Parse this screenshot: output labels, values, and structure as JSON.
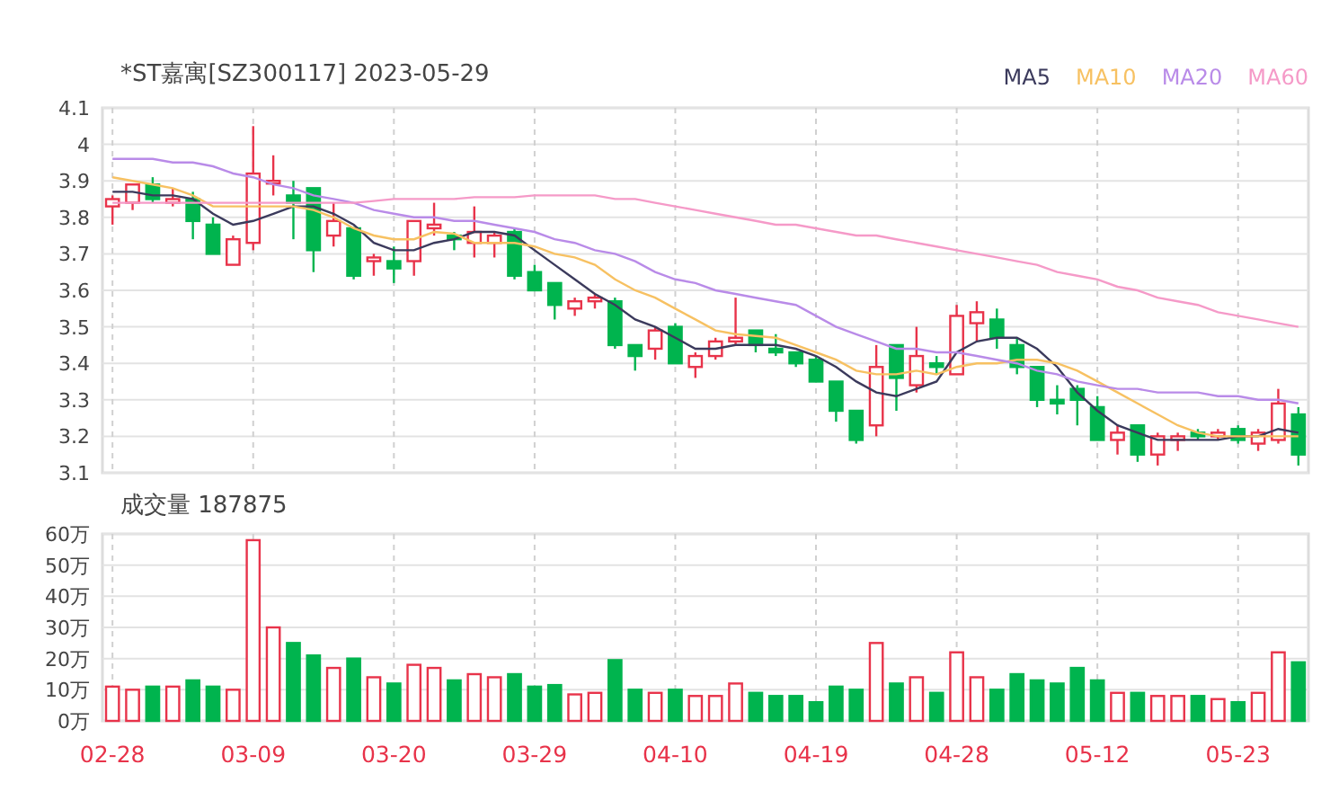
{
  "header": {
    "title": "*ST嘉寓[SZ300117] 2023-05-29"
  },
  "price_chart": {
    "chart_data": {
      "type": "candlestick",
      "grid": true,
      "ylim": [
        3.1,
        4.1
      ],
      "yticks": [
        3.1,
        3.2,
        3.3,
        3.4,
        3.5,
        3.6,
        3.7,
        3.8,
        3.9,
        4,
        4.1
      ],
      "categories": [
        null,
        null,
        null,
        null,
        null,
        null,
        null,
        null,
        null,
        null,
        null,
        null,
        null,
        null,
        null,
        null,
        null,
        null,
        null,
        null,
        null,
        null,
        null,
        null,
        null,
        null,
        null,
        null,
        null,
        null,
        null,
        null,
        null,
        null,
        null,
        null,
        null,
        null,
        null,
        null,
        null,
        null,
        null,
        null,
        null,
        null,
        null,
        null,
        null,
        null,
        null,
        null,
        null,
        null,
        null,
        null,
        null,
        null,
        null,
        null
      ],
      "ohlc": [
        [
          3.83,
          3.86,
          3.78,
          3.85
        ],
        [
          3.84,
          3.89,
          3.82,
          3.89
        ],
        [
          3.89,
          3.91,
          3.84,
          3.85
        ],
        [
          3.84,
          3.88,
          3.83,
          3.85
        ],
        [
          3.85,
          3.87,
          3.74,
          3.79
        ],
        [
          3.78,
          3.8,
          3.7,
          3.7
        ],
        [
          3.67,
          3.75,
          3.67,
          3.74
        ],
        [
          3.73,
          4.05,
          3.71,
          3.92
        ],
        [
          3.895,
          3.97,
          3.86,
          3.9
        ],
        [
          3.86,
          3.9,
          3.74,
          3.84
        ],
        [
          3.88,
          3.88,
          3.65,
          3.71
        ],
        [
          3.75,
          3.84,
          3.72,
          3.79
        ],
        [
          3.77,
          3.77,
          3.63,
          3.64
        ],
        [
          3.68,
          3.7,
          3.64,
          3.69
        ],
        [
          3.68,
          3.72,
          3.62,
          3.66
        ],
        [
          3.68,
          3.79,
          3.64,
          3.79
        ],
        [
          3.77,
          3.84,
          3.75,
          3.78
        ],
        [
          3.75,
          3.76,
          3.71,
          3.74
        ],
        [
          3.73,
          3.83,
          3.69,
          3.76
        ],
        [
          3.73,
          3.76,
          3.69,
          3.75
        ],
        [
          3.76,
          3.77,
          3.63,
          3.64
        ],
        [
          3.65,
          3.67,
          3.6,
          3.6
        ],
        [
          3.62,
          3.62,
          3.52,
          3.56
        ],
        [
          3.55,
          3.58,
          3.53,
          3.57
        ],
        [
          3.57,
          3.59,
          3.55,
          3.58
        ],
        [
          3.57,
          3.58,
          3.44,
          3.45
        ],
        [
          3.45,
          3.45,
          3.38,
          3.42
        ],
        [
          3.44,
          3.5,
          3.41,
          3.49
        ],
        [
          3.5,
          3.51,
          3.4,
          3.4
        ],
        [
          3.39,
          3.43,
          3.36,
          3.42
        ],
        [
          3.42,
          3.47,
          3.41,
          3.46
        ],
        [
          3.46,
          3.58,
          3.45,
          3.47
        ],
        [
          3.49,
          3.49,
          3.43,
          3.45
        ],
        [
          3.44,
          3.48,
          3.42,
          3.43
        ],
        [
          3.43,
          3.43,
          3.39,
          3.4
        ],
        [
          3.41,
          3.42,
          3.35,
          3.35
        ],
        [
          3.35,
          3.35,
          3.24,
          3.27
        ],
        [
          3.27,
          3.27,
          3.18,
          3.19
        ],
        [
          3.23,
          3.45,
          3.2,
          3.39
        ],
        [
          3.45,
          3.45,
          3.27,
          3.36
        ],
        [
          3.34,
          3.5,
          3.32,
          3.42
        ],
        [
          3.4,
          3.42,
          3.37,
          3.39
        ],
        [
          3.37,
          3.56,
          3.37,
          3.53
        ],
        [
          3.51,
          3.57,
          3.46,
          3.54
        ],
        [
          3.52,
          3.55,
          3.44,
          3.47
        ],
        [
          3.45,
          3.47,
          3.37,
          3.39
        ],
        [
          3.39,
          3.39,
          3.28,
          3.3
        ],
        [
          3.3,
          3.34,
          3.26,
          3.29
        ],
        [
          3.33,
          3.34,
          3.23,
          3.3
        ],
        [
          3.28,
          3.31,
          3.19,
          3.19
        ],
        [
          3.19,
          3.23,
          3.15,
          3.21
        ],
        [
          3.23,
          3.23,
          3.13,
          3.15
        ],
        [
          3.15,
          3.21,
          3.12,
          3.2
        ],
        [
          3.19,
          3.21,
          3.16,
          3.2
        ],
        [
          3.21,
          3.22,
          3.19,
          3.2
        ],
        [
          3.2,
          3.22,
          3.19,
          3.21
        ],
        [
          3.22,
          3.23,
          3.18,
          3.19
        ],
        [
          3.18,
          3.22,
          3.16,
          3.21
        ],
        [
          3.19,
          3.33,
          3.18,
          3.29
        ],
        [
          3.26,
          3.28,
          3.12,
          3.15
        ]
      ],
      "series": [
        {
          "name": "MA5",
          "type": "line",
          "color": "#3b3a5c",
          "values": [
            3.87,
            3.87,
            3.86,
            3.86,
            3.85,
            3.81,
            3.78,
            3.79,
            3.81,
            3.83,
            3.83,
            3.81,
            3.78,
            3.73,
            3.71,
            3.71,
            3.73,
            3.74,
            3.76,
            3.76,
            3.75,
            3.71,
            3.67,
            3.63,
            3.59,
            3.56,
            3.52,
            3.5,
            3.47,
            3.44,
            3.44,
            3.45,
            3.45,
            3.45,
            3.44,
            3.42,
            3.39,
            3.35,
            3.32,
            3.31,
            3.33,
            3.35,
            3.43,
            3.46,
            3.47,
            3.47,
            3.44,
            3.39,
            3.32,
            3.27,
            3.23,
            3.21,
            3.19,
            3.19,
            3.19,
            3.19,
            3.2,
            3.2,
            3.22,
            3.21
          ]
        },
        {
          "name": "MA10",
          "type": "line",
          "color": "#f7c162",
          "values": [
            3.91,
            3.9,
            3.89,
            3.88,
            3.86,
            3.83,
            3.83,
            3.83,
            3.83,
            3.83,
            3.82,
            3.8,
            3.77,
            3.75,
            3.74,
            3.74,
            3.76,
            3.755,
            3.73,
            3.73,
            3.73,
            3.72,
            3.7,
            3.69,
            3.67,
            3.63,
            3.6,
            3.58,
            3.55,
            3.52,
            3.49,
            3.48,
            3.475,
            3.47,
            3.45,
            3.43,
            3.41,
            3.38,
            3.37,
            3.37,
            3.38,
            3.37,
            3.39,
            3.4,
            3.4,
            3.41,
            3.41,
            3.4,
            3.38,
            3.35,
            3.32,
            3.29,
            3.26,
            3.23,
            3.21,
            3.2,
            3.2,
            3.2,
            3.2,
            3.2
          ]
        },
        {
          "name": "MA20",
          "type": "line",
          "color": "#b98be8",
          "values": [
            3.96,
            3.96,
            3.96,
            3.95,
            3.95,
            3.94,
            3.92,
            3.91,
            3.89,
            3.88,
            3.86,
            3.85,
            3.84,
            3.82,
            3.81,
            3.8,
            3.8,
            3.79,
            3.79,
            3.78,
            3.77,
            3.76,
            3.74,
            3.73,
            3.71,
            3.7,
            3.68,
            3.65,
            3.63,
            3.62,
            3.6,
            3.59,
            3.58,
            3.57,
            3.56,
            3.53,
            3.5,
            3.48,
            3.46,
            3.44,
            3.44,
            3.43,
            3.43,
            3.42,
            3.41,
            3.4,
            3.38,
            3.37,
            3.35,
            3.34,
            3.33,
            3.33,
            3.32,
            3.32,
            3.32,
            3.31,
            3.31,
            3.3,
            3.3,
            3.29
          ]
        },
        {
          "name": "MA60",
          "type": "line",
          "color": "#f59ac8",
          "values": [
            3.84,
            3.84,
            3.84,
            3.84,
            3.84,
            3.84,
            3.84,
            3.84,
            3.84,
            3.84,
            3.84,
            3.84,
            3.84,
            3.845,
            3.85,
            3.85,
            3.85,
            3.85,
            3.855,
            3.855,
            3.855,
            3.86,
            3.86,
            3.86,
            3.86,
            3.85,
            3.85,
            3.84,
            3.83,
            3.82,
            3.81,
            3.8,
            3.79,
            3.78,
            3.78,
            3.77,
            3.76,
            3.75,
            3.75,
            3.74,
            3.73,
            3.72,
            3.71,
            3.7,
            3.69,
            3.68,
            3.67,
            3.65,
            3.64,
            3.63,
            3.61,
            3.6,
            3.58,
            3.57,
            3.56,
            3.54,
            3.53,
            3.52,
            3.51,
            3.5
          ]
        }
      ]
    }
  },
  "volume_chart": {
    "chart_data": {
      "type": "bar",
      "grid": true,
      "title": "成交量 187875",
      "ylim": [
        0,
        60
      ],
      "yticks": [
        {
          "value": 0,
          "label": "0万"
        },
        {
          "value": 10,
          "label": "10万"
        },
        {
          "value": 20,
          "label": "20万"
        },
        {
          "value": 30,
          "label": "30万"
        },
        {
          "value": 40,
          "label": "40万"
        },
        {
          "value": 50,
          "label": "50万"
        },
        {
          "value": 60,
          "label": "60万"
        }
      ],
      "categories": [
        "02-28",
        null,
        null,
        null,
        null,
        null,
        null,
        "03-09",
        null,
        null,
        null,
        null,
        null,
        null,
        "03-20",
        null,
        null,
        null,
        null,
        null,
        null,
        "03-29",
        null,
        null,
        null,
        null,
        null,
        null,
        "04-10",
        null,
        null,
        null,
        null,
        null,
        null,
        "04-19",
        null,
        null,
        null,
        null,
        null,
        null,
        "04-28",
        null,
        null,
        null,
        null,
        null,
        null,
        "05-12",
        null,
        null,
        null,
        null,
        null,
        null,
        "05-23",
        null,
        null,
        null
      ],
      "values": [
        11,
        10,
        11,
        11,
        13,
        11,
        10,
        58,
        30,
        25,
        21,
        17,
        20,
        14,
        12,
        18,
        17,
        13,
        15,
        14,
        15,
        11,
        11.5,
        8.5,
        9,
        19.5,
        10,
        9,
        10,
        8,
        8,
        12,
        9,
        8,
        8,
        6,
        11,
        10,
        25,
        12,
        14,
        9,
        22,
        14,
        10,
        15,
        13,
        12,
        17,
        13,
        9,
        9,
        8,
        8,
        8,
        7,
        6,
        9,
        22,
        18.8
      ]
    }
  }
}
